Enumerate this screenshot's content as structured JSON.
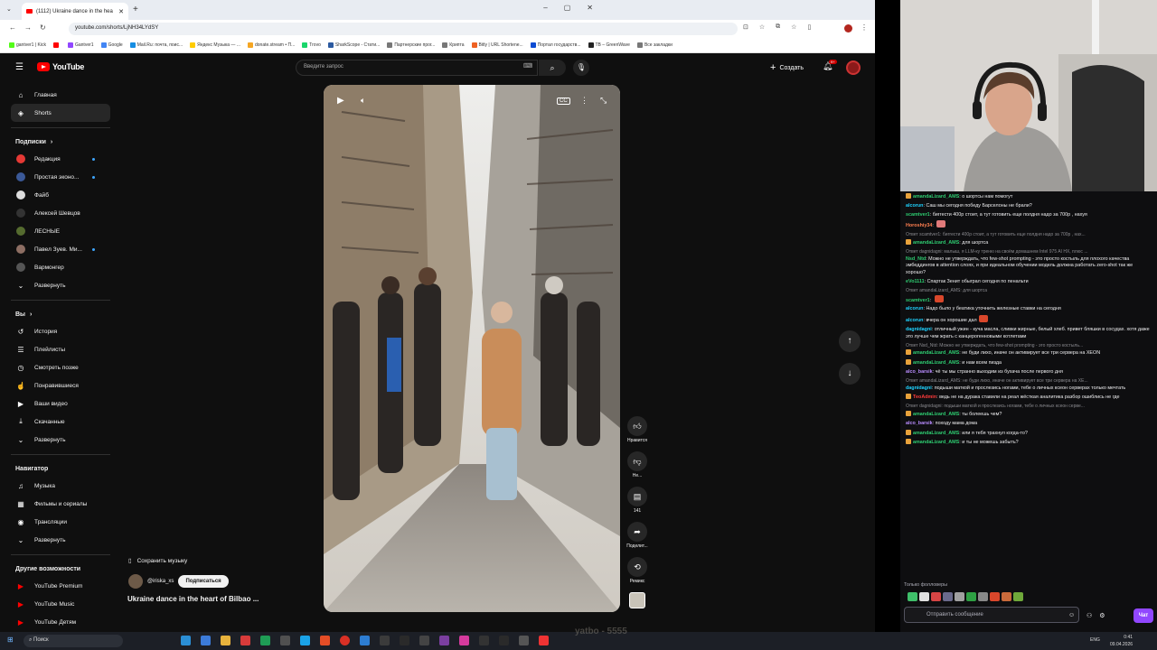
{
  "browser": {
    "tab_title": "(1112) Ukraine dance in the hea",
    "url": "youtube.com/shorts/LjNH34LYdSY",
    "bookmarks": [
      {
        "label": "gantver1 | Kick",
        "color": "#53fc18"
      },
      {
        "label": "",
        "color": "#ff0000"
      },
      {
        "label": "Gantver1",
        "color": "#9147ff"
      },
      {
        "label": "Google",
        "color": "#4285f4"
      },
      {
        "label": "Mail.Ru: почта, поис...",
        "color": "#168de2"
      },
      {
        "label": "Яндекс Музыка — ...",
        "color": "#ffcc00"
      },
      {
        "label": "donate.stream • П...",
        "color": "#f5a623"
      },
      {
        "label": "Trovo",
        "color": "#19d66b"
      },
      {
        "label": "SharkScope - Стати...",
        "color": "#2c5aa0"
      },
      {
        "label": "Партнерские прог...",
        "color": "#777777"
      },
      {
        "label": "Крипта",
        "color": "#777777"
      },
      {
        "label": "Bitly | URL Shortene...",
        "color": "#ee6123"
      },
      {
        "label": "Портал государств...",
        "color": "#0d4cd3"
      },
      {
        "label": "TB – GreenWave",
        "color": "#222222"
      },
      {
        "label": "Все закладки",
        "color": "#777777"
      }
    ]
  },
  "youtube": {
    "logo_text": "YouTube",
    "search_placeholder": "Введите запрос",
    "create_label": "Создать",
    "bell_badge": "9+",
    "sidebar": {
      "main": [
        {
          "label": "Главная",
          "icon": "home-icon",
          "glyph": "⌂"
        },
        {
          "label": "Shorts",
          "icon": "shorts-icon",
          "glyph": "◈",
          "active": true
        }
      ],
      "subs_header": "Подписки",
      "subs": [
        {
          "label": "Редакция",
          "color": "#e53935",
          "dot": true
        },
        {
          "label": "Простая эконо...",
          "color": "#3b5998",
          "dot": true
        },
        {
          "label": "Файб",
          "color": "#dddddd",
          "dot": false
        },
        {
          "label": "Алексей Шевцов",
          "color": "#333333",
          "dot": false
        },
        {
          "label": "ЛЕСНЫЕ",
          "color": "#556b2f",
          "dot": false
        },
        {
          "label": "Павел Зуев. Ми...",
          "color": "#8d6e63",
          "dot": true
        },
        {
          "label": "Вармонгер",
          "color": "#555555",
          "dot": false
        }
      ],
      "subs_expand": "Развернуть",
      "you_header": "Вы",
      "you": [
        {
          "label": "История",
          "glyph": "↺"
        },
        {
          "label": "Плейлисты",
          "glyph": "☰"
        },
        {
          "label": "Смотреть позже",
          "glyph": "◷"
        },
        {
          "label": "Понравившиеся",
          "glyph": "☝"
        },
        {
          "label": "Ваши видео",
          "glyph": "▶"
        },
        {
          "label": "Скачанные",
          "glyph": "⤓"
        }
      ],
      "you_expand": "Развернуть",
      "nav_header": "Навигатор",
      "nav": [
        {
          "label": "Музыка",
          "glyph": "♫"
        },
        {
          "label": "Фильмы и сериалы",
          "glyph": "▦"
        },
        {
          "label": "Трансляции",
          "glyph": "◉"
        }
      ],
      "nav_expand": "Развернуть",
      "more_header": "Другие возможности",
      "more": [
        {
          "label": "YouTube Premium"
        },
        {
          "label": "YouTube Music"
        },
        {
          "label": "YouTube Детям"
        }
      ]
    },
    "short": {
      "save_music": "Сохранить музыку",
      "channel": "@iriska_xs",
      "subscribe": "Подписаться",
      "title": "Ukraine dance in the heart of Bilbao ...",
      "actions": {
        "like": "Нравится",
        "dislike": "Не...",
        "comments": "141",
        "share": "Поделит...",
        "remix": "Ремикс"
      }
    }
  },
  "taskbar": {
    "search": "Поиск",
    "lang": "ENG",
    "time": "0:41",
    "date": "09.04.2026"
  },
  "chat": {
    "messages": [
      {
        "user": "amandaLizard_AMS",
        "color": "#2ecc71",
        "text": "о шортсы нам помогут",
        "badge": true
      },
      {
        "user": "alcorun",
        "color": "#1fd2ff",
        "text": "Саш мы сегодня победу Барселоны не брали?"
      },
      {
        "user": "scamtver1",
        "color": "#2ecc71",
        "text": "биггести 400р стоит, а тут готовить еще полдня надо за 700р , нахуя"
      },
      {
        "user": "Horoshiy34",
        "color": "#ff7f50",
        "text": "",
        "emote": "#e07a7a"
      },
      {
        "reply": "Ответ scamtver1: биггести 400р стоит, а тут готовить еще полдня надо за 700р , нах..."
      },
      {
        "user": "amandaLizard_AMS",
        "color": "#2ecc71",
        "text": "для шортса",
        "badge": true
      },
      {
        "reply": "Ответ dagnidagni: малыш, я LLM-ку треню на своём домашнем Intel 975 AI HX, плюс ..."
      },
      {
        "user": "Nsd_Ntd",
        "color": "#2ecc71",
        "text": "Можно не утверждать, что few-shot prompting - это просто костыль для плохого качества эмбеддингов в attention слоях, и при идеальном обучении модель должна работать zero-shot так же хорошо?"
      },
      {
        "user": "eVo1111",
        "color": "#2ecc71",
        "text": "Спартак Зенит обыграл сегодня по пенальти"
      },
      {
        "reply": "Ответ amandaLizard_AMS: для шортса"
      },
      {
        "user": "scamtver1",
        "color": "#2ecc71",
        "text": "",
        "emote": "#d9472b"
      },
      {
        "user": "alcorun",
        "color": "#1fd2ff",
        "text": "Надо было у беатика уточнить железные ставки на сегодня"
      },
      {
        "user": "alcorun",
        "color": "#1fd2ff",
        "text": "вчера он хорошие дал",
        "emote": "#d9472b"
      },
      {
        "user": "dagnidagni",
        "color": "#1fd2ff",
        "text": "отличный ужин - куча масла, сливки жирные, белый хлеб. привет бляшки в сосудах. хотя даже это лучше чем жрать с канцерогенновыми котлетами"
      },
      {
        "reply": "Ответ Nsd_Ntd: Можно не утверждать, что few-shot prompting - это просто костыль..."
      },
      {
        "user": "amandaLizard_AMS",
        "color": "#2ecc71",
        "text": "не буди лихо, иначе он активирует все три сервера на XEON",
        "badge": true
      },
      {
        "user": "amandaLizard_AMS",
        "color": "#2ecc71",
        "text": "и нам всем пизда",
        "badge": true
      },
      {
        "user": "alco_barsik",
        "color": "#b98cff",
        "text": "чё ты мы странно выходим из бухача после первого дня"
      },
      {
        "reply": "Ответ amandaLizard_AMS: не буди лихо, иначе он активирует все три сервера на XE..."
      },
      {
        "user": "dagnidagni",
        "color": "#1fd2ff",
        "text": "подыши маткой и прослезись ногами, тебе о личных ксеон серверах только мечтать"
      },
      {
        "user": "ТеоАdmin",
        "color": "#ff3b3b",
        "text": "ведь не на дурака ставили на реал жёсткая аналитика разбор ошиблись не где",
        "badge": true
      },
      {
        "reply": "Ответ dagnidagni: подыши маткой и прослезись ногами, тебе о личных ксеон серве..."
      },
      {
        "user": "amandaLizard_AMS",
        "color": "#2ecc71",
        "text": "ты болеешь чем?",
        "badge": true
      },
      {
        "user": "alco_barsik",
        "color": "#b98cff",
        "text": "походу мама дома"
      },
      {
        "user": "amandaLizard_AMS",
        "color": "#2ecc71",
        "text": "или я тебя трахнул когда-то?",
        "badge": true
      },
      {
        "user": "amandaLizard_AMS",
        "color": "#2ecc71",
        "text": "и ты не можешь забыть?",
        "badge": true
      }
    ],
    "followers_only": "Только фолловеры",
    "emotes": [
      "#3fbf6a",
      "#e0e0e0",
      "#d64545",
      "#6a6a8c",
      "#a0a0a0",
      "#2ea043",
      "#888888",
      "#d9472b",
      "#c96a3b",
      "#6fa83a"
    ],
    "input_placeholder": "Отправить сообщение",
    "send_label": "Чат"
  },
  "overlay": {
    "watermark": "yatbo - 5555"
  }
}
